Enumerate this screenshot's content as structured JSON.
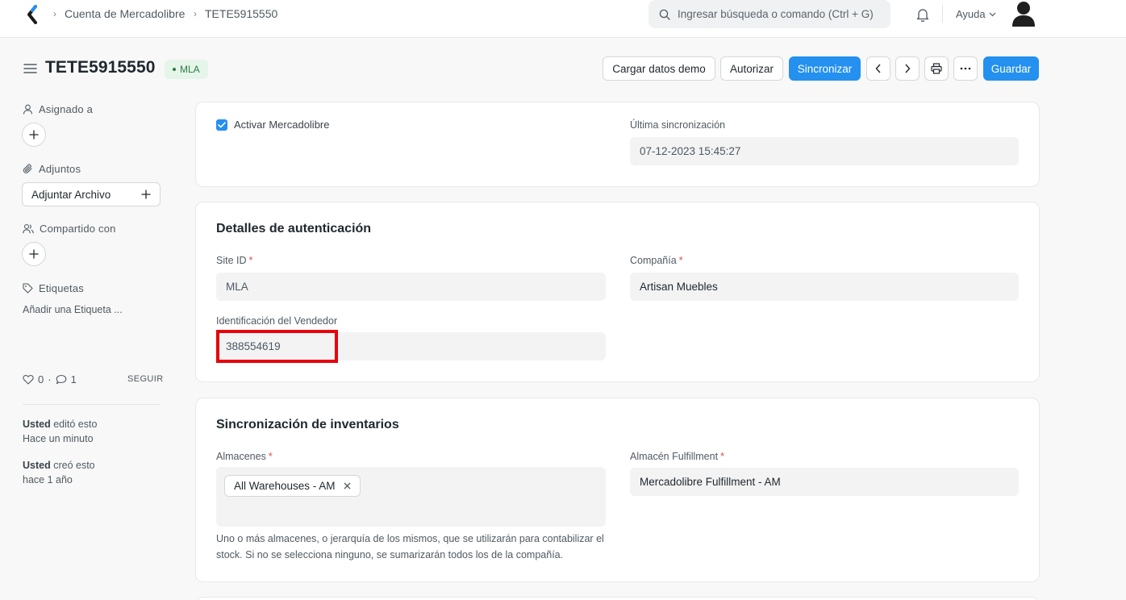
{
  "navbar": {
    "breadcrumbs": [
      "Cuenta de Mercadolibre",
      "TETE5915550"
    ],
    "search_placeholder": "Ingresar búsqueda o comando (Ctrl + G)",
    "help_label": "Ayuda"
  },
  "header": {
    "title": "TETE5915550",
    "status": "MLA",
    "buttons": {
      "demo": "Cargar datos demo",
      "authorize": "Autorizar",
      "sync": "Sincronizar",
      "save": "Guardar"
    }
  },
  "sidebar": {
    "assigned_to": "Asignado a",
    "attachments": "Adjuntos",
    "attach_file": "Adjuntar Archivo",
    "shared_with": "Compartido con",
    "tags": "Etiquetas",
    "add_tag": "Añadir una Etiqueta ...",
    "likes": "0",
    "comments": "1",
    "follow": "SEGUIR",
    "activity": [
      {
        "user": "Usted",
        "action": "editó esto",
        "time": "Hace un minuto"
      },
      {
        "user": "Usted",
        "action": "creó esto",
        "time": "hace 1 año"
      }
    ]
  },
  "section_activation": {
    "enable_label": "Activar Mercadolibre",
    "enabled": true,
    "last_sync_label": "Última sincronización",
    "last_sync_value": "07-12-2023 15:45:27"
  },
  "section_auth": {
    "title": "Detalles de autenticación",
    "site_id_label": "Site ID",
    "site_id_value": "MLA",
    "company_label": "Compañía",
    "company_value": "Artisan Muebles",
    "seller_id_label": "Identificación del Vendedor",
    "seller_id_value": "388554619"
  },
  "section_inventory": {
    "title": "Sincronización de inventarios",
    "warehouses_label": "Almacenes",
    "warehouses": [
      "All Warehouses - AM"
    ],
    "fulfillment_label": "Almacén Fulfillment",
    "fulfillment_value": "Mercadolibre Fulfillment - AM",
    "help_text": "Uno o más almacenes, o jerarquía de los mismos, que se utilizarán para contabilizar el stock. Si no se selecciona ninguno, se sumarizarán todos los de la compañía."
  },
  "colors": {
    "primary": "#2490ef",
    "highlight": "#e8000b",
    "status_bg": "#e5f5ea",
    "status_text": "#2d7a48"
  }
}
